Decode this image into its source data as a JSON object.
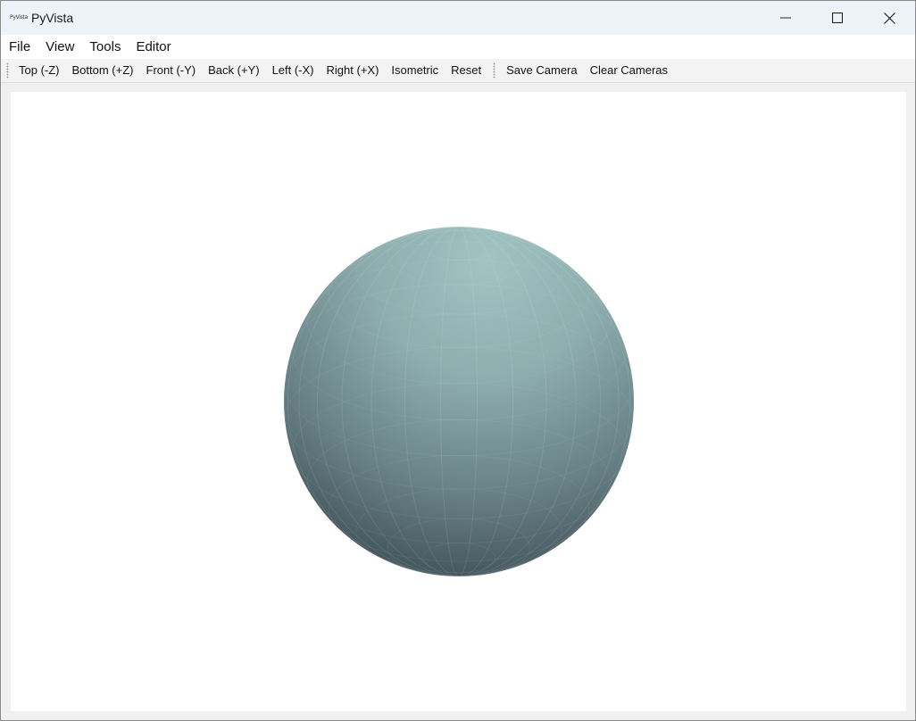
{
  "window": {
    "title": "PyVista",
    "app_icon_text": "PyVista"
  },
  "menubar": {
    "items": [
      "File",
      "View",
      "Tools",
      "Editor"
    ]
  },
  "toolbar": {
    "view_buttons": [
      "Top (-Z)",
      "Bottom (+Z)",
      "Front (-Y)",
      "Back (+Y)",
      "Left (-X)",
      "Right (+X)",
      "Isometric",
      "Reset"
    ],
    "camera_buttons": [
      "Save Camera",
      "Clear Cameras"
    ]
  },
  "scene": {
    "object": "sphere-mesh",
    "mesh_color": "#8aa7a8",
    "background_color": "#ffffff"
  }
}
